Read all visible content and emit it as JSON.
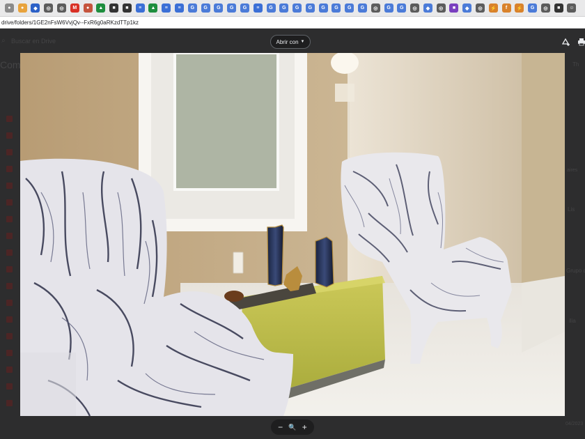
{
  "browser": {
    "tabs": [
      {
        "icon": "chrome-icon",
        "color": "#8a8a8a"
      },
      {
        "icon": "google-multicolor-icon",
        "color": "#e8a33d"
      },
      {
        "icon": "shield-icon",
        "color": "#2b60c7"
      },
      {
        "icon": "globe-icon",
        "color": "#5c5c5c"
      },
      {
        "icon": "globe-icon",
        "color": "#5c5c5c"
      },
      {
        "icon": "gmail-icon",
        "color": "#d93025"
      },
      {
        "icon": "google-multicolor-icon",
        "color": "#c5543d"
      },
      {
        "icon": "drive-icon",
        "color": "#1e8e3e"
      },
      {
        "icon": "app-icon",
        "color": "#333333"
      },
      {
        "icon": "app-icon",
        "color": "#333333"
      },
      {
        "icon": "docs-icon",
        "color": "#3b6fd6"
      },
      {
        "icon": "drive-icon",
        "color": "#1e8e3e"
      },
      {
        "icon": "docs-icon",
        "color": "#3b6fd6"
      },
      {
        "icon": "docs-icon",
        "color": "#3b6fd6"
      },
      {
        "icon": "g-icon",
        "color": "#4b7bd8"
      },
      {
        "icon": "g-icon",
        "color": "#4b7bd8"
      },
      {
        "icon": "g-icon",
        "color": "#4b7bd8"
      },
      {
        "icon": "g-icon",
        "color": "#4b7bd8"
      },
      {
        "icon": "g-icon",
        "color": "#4b7bd8"
      },
      {
        "icon": "docs-icon",
        "color": "#3b6fd6"
      },
      {
        "icon": "g-icon",
        "color": "#4b7bd8"
      },
      {
        "icon": "g-icon",
        "color": "#4b7bd8"
      },
      {
        "icon": "g-icon",
        "color": "#4b7bd8"
      },
      {
        "icon": "g-icon",
        "color": "#4b7bd8"
      },
      {
        "icon": "g-icon",
        "color": "#4b7bd8"
      },
      {
        "icon": "g-icon",
        "color": "#4b7bd8"
      },
      {
        "icon": "g-icon",
        "color": "#4b7bd8"
      },
      {
        "icon": "g-icon",
        "color": "#4b7bd8"
      },
      {
        "icon": "globe-icon",
        "color": "#5c5c5c"
      },
      {
        "icon": "g-icon",
        "color": "#4b7bd8"
      },
      {
        "icon": "g-icon",
        "color": "#4b7bd8"
      },
      {
        "icon": "globe-icon",
        "color": "#5c5c5c"
      },
      {
        "icon": "diamond-icon",
        "color": "#4b7bd8"
      },
      {
        "icon": "globe-icon",
        "color": "#5c5c5c"
      },
      {
        "icon": "app-icon",
        "color": "#7a3fbf"
      },
      {
        "icon": "diamond-icon",
        "color": "#4b7bd8"
      },
      {
        "icon": "globe-icon",
        "color": "#5c5c5c"
      },
      {
        "icon": "lightning-icon",
        "color": "#d9822b"
      },
      {
        "icon": "circle-f-icon",
        "color": "#d9822b"
      },
      {
        "icon": "lightning-icon",
        "color": "#d9822b"
      },
      {
        "icon": "g-icon",
        "color": "#4b7bd8"
      },
      {
        "icon": "globe-icon",
        "color": "#5c5c5c"
      },
      {
        "icon": "app-icon",
        "color": "#333333"
      },
      {
        "icon": "alien-icon",
        "color": "#5c5c5c"
      }
    ],
    "url": "drive/folders/1GE2nFsW6VvjQv--FxR6g0aRKzdTTp1kz"
  },
  "drive_background": {
    "search_placeholder": "Buscar en Drive",
    "heading": "Com",
    "right_labels": [
      "Th",
      "Lis",
      "Grupo de",
      "ilia"
    ],
    "right_small": [
      "aires",
      "04/2023"
    ]
  },
  "viewer": {
    "open_with_label": "Abrir con",
    "zoom_out_label": "−",
    "zoom_label": "🔍",
    "zoom_in_label": "+",
    "photo_description": "Two marble-print wingback armchairs beside a glass side table with dark vases under a mirror"
  }
}
